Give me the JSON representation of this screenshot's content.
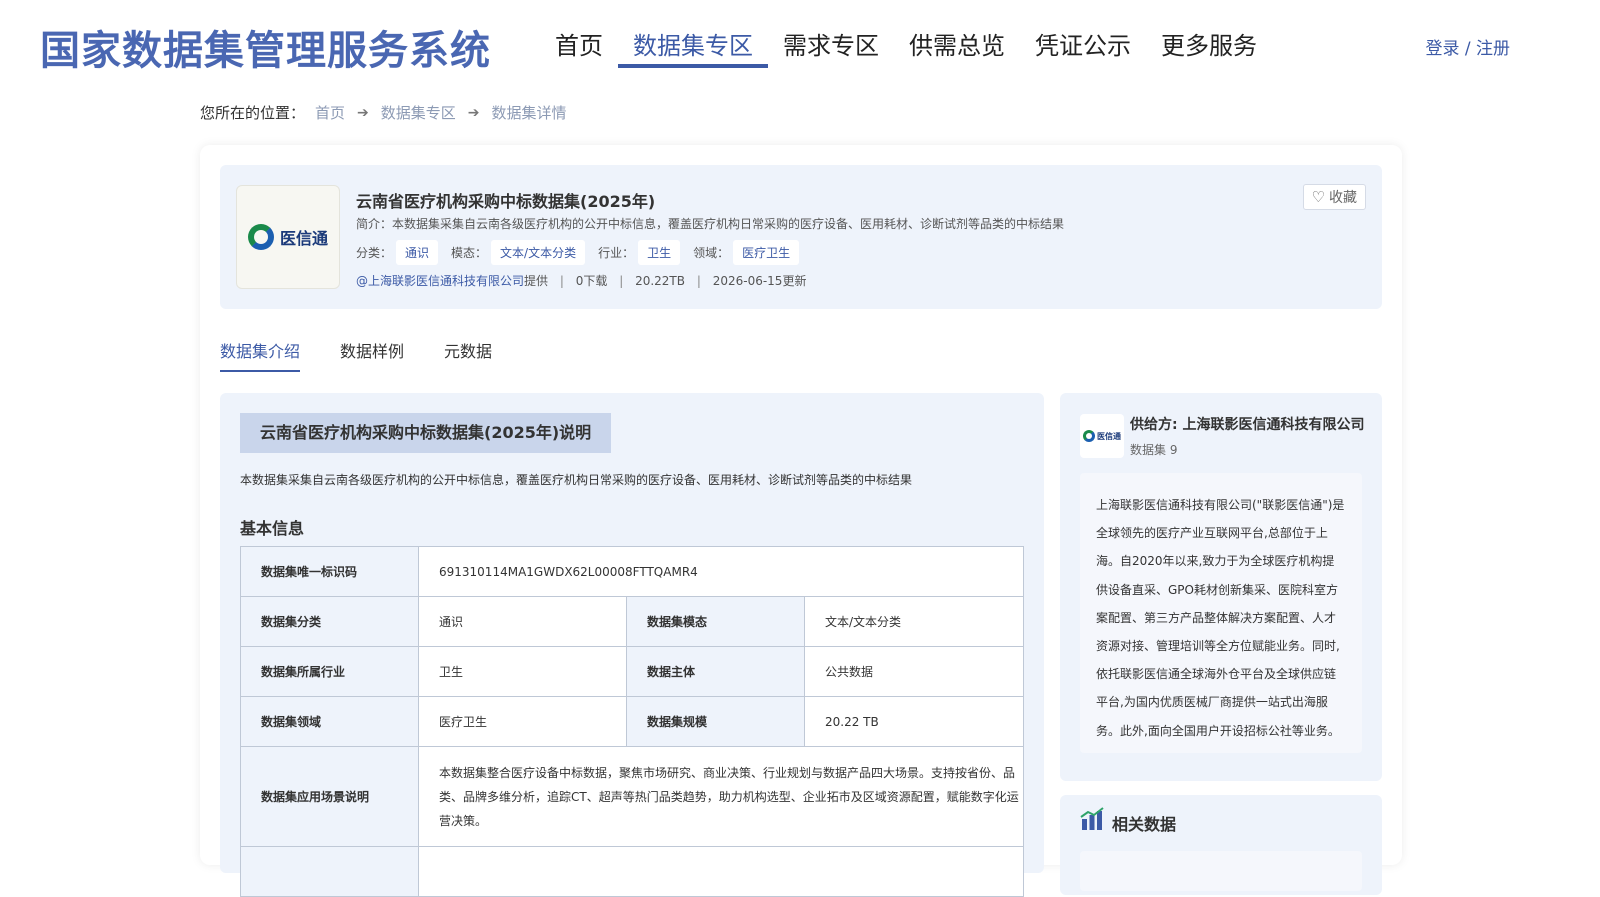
{
  "site": {
    "title": "国家数据集管理服务系统",
    "login": "登录 / 注册"
  },
  "nav": [
    "首页",
    "数据集专区",
    "需求专区",
    "供需总览",
    "凭证公示",
    "更多服务"
  ],
  "breadcrumb": {
    "prefix": "您所在的位置：",
    "items": [
      "首页",
      "数据集专区",
      "数据集详情"
    ]
  },
  "dataset": {
    "logo_text": "医信通",
    "title": "云南省医疗机构采购中标数据集(2025年)",
    "intro": "简介：本数据集采集自云南各级医疗机构的公开中标信息，覆盖医疗机构日常采购的医疗设备、医用耗材、诊断试剂等品类的中标结果",
    "tags": [
      {
        "label": "分类：",
        "value": "通识"
      },
      {
        "label": "模态：",
        "value": "文本/文本分类"
      },
      {
        "label": "行业：",
        "value": "卫生"
      },
      {
        "label": "领域：",
        "value": "医疗卫生"
      }
    ],
    "provider": "@上海联影医信通科技有限公司",
    "provider_suffix": "提供",
    "downloads": "0下载",
    "size": "20.22TB",
    "updated": "2026-06-15更新",
    "favorite": "收藏"
  },
  "tabs": [
    "数据集介绍",
    "数据样例",
    "元数据"
  ],
  "intro_section": {
    "title": "云南省医疗机构采购中标数据集(2025年)说明",
    "desc": "本数据集采集自云南各级医疗机构的公开中标信息，覆盖医疗机构日常采购的医疗设备、医用耗材、诊断试剂等品类的中标结果",
    "basic_title": "基本信息",
    "table": {
      "id_label": "数据集唯一标识码",
      "id_value": "691310114MA1GWDX62L00008FTTQAMR4",
      "category_label": "数据集分类",
      "category_value": "通识",
      "modality_label": "数据集模态",
      "modality_value": "文本/文本分类",
      "industry_label": "数据集所属行业",
      "industry_value": "卫生",
      "subject_label": "数据主体",
      "subject_value": "公共数据",
      "domain_label": "数据集领域",
      "domain_value": "医疗卫生",
      "scale_label": "数据集规模",
      "scale_value": "20.22 TB",
      "scenario_label": "数据集应用场景说明",
      "scenario_value": "本数据集整合医疗设备中标数据，聚焦市场研究、商业决策、行业规划与数据产品四大场景。支持按省份、品类、品牌多维分析，追踪CT、超声等热门品类趋势，助力机构选型、企业拓市及区域资源配置，赋能数字化运营决策。"
    }
  },
  "supplier": {
    "name": "供给方: 上海联影医信通科技有限公司",
    "count": "数据集 9",
    "logo_text": "医信通",
    "desc": "上海联影医信通科技有限公司(\"联影医信通\")是全球领先的医疗产业互联网平台,总部位于上海。自2020年以来,致力于为全球医疗机构提供设备直采、GPO耗材创新集采、医院科室方案配置、第三方产品整体解决方案配置、人才资源对接、管理培训等全方位赋能业务。同时,依托联影医信通全球海外仓平台及全球供应链平台,为国内优质医械厂商提供一站式出海服务。此外,面向全国用户开设招标公社等业务。"
  },
  "related": {
    "title": "相关数据"
  },
  "colors": {
    "accent": "#3c5aa6",
    "panel_bg": "#eef3fb",
    "title_blue": "#4a67b2"
  }
}
